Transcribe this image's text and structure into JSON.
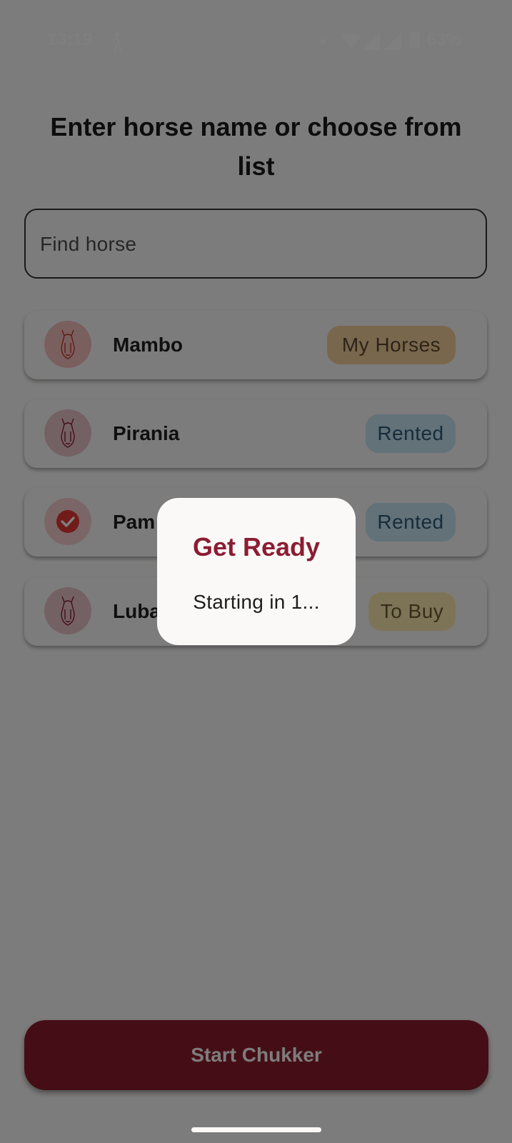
{
  "status_bar": {
    "time": "13:19",
    "battery_percent": "63%",
    "icons": [
      "walking-icon",
      "notification-dot-icon",
      "wifi-icon",
      "signal-icon",
      "signal-icon",
      "battery-icon"
    ]
  },
  "page": {
    "title": "Enter horse name or choose from list",
    "search": {
      "placeholder": "Find horse",
      "value": ""
    }
  },
  "horses": [
    {
      "name": "Mambo",
      "badge": "My Horses",
      "avatar": "horse-head-icon",
      "selected": false
    },
    {
      "name": "Pirania",
      "badge": "Rented",
      "avatar": "horse-head-icon",
      "selected": false
    },
    {
      "name": "Pam",
      "badge": "Rented",
      "avatar": "check-icon",
      "selected": true
    },
    {
      "name": "Luba",
      "badge": "To Buy",
      "avatar": "horse-head-icon",
      "selected": false
    }
  ],
  "action": {
    "start_label": "Start Chukker"
  },
  "dialog": {
    "title": "Get Ready",
    "message": "Starting in 1..."
  },
  "colors": {
    "brand": "#8b1d32",
    "badge_my_horses": "#f2ce9a",
    "badge_rented": "#c6e2f0",
    "badge_to_buy": "#fbe8b1"
  }
}
